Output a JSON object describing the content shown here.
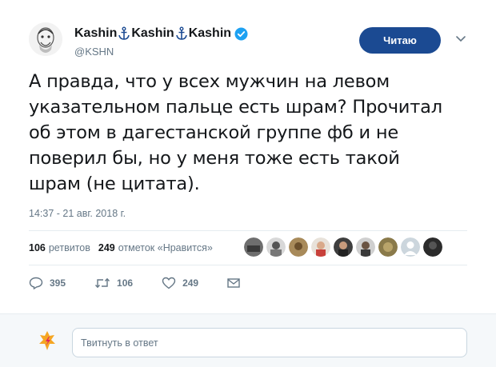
{
  "author": {
    "name_parts": [
      "Kashin",
      "Kashin",
      "Kashin"
    ],
    "handle": "@KSHN",
    "avatar": "avatar-sketch-icon"
  },
  "follow_button": {
    "label": "Читаю"
  },
  "tweet": {
    "lines": [
      "А правда, что у всех мужчин на левом",
      "указательном пальце есть шрам? Прочитал",
      "об этом в дагестанской группе фб и не",
      "поверил бы, но у меня тоже есть такой",
      "шрам (не цитата)."
    ],
    "timestamp": "14:37 - 21 авг. 2018 г."
  },
  "stats": {
    "retweets_count": "106",
    "retweets_label": "ретвитов",
    "likes_count": "249",
    "likes_label": "отметок «Нравится»"
  },
  "actions": {
    "replies": "395",
    "retweets": "106",
    "likes": "249"
  },
  "reply": {
    "placeholder": "Твитнуть в ответ"
  },
  "colors": {
    "follow_button": "#1b4a92",
    "verified": "#1da1f2",
    "secondary_text": "#657786",
    "anchor": "#1b4a92"
  }
}
